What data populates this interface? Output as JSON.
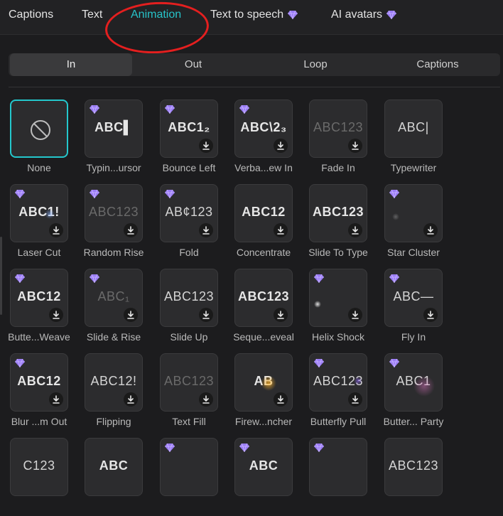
{
  "top_tabs": [
    {
      "label": "Captions",
      "active": false,
      "premium": false
    },
    {
      "label": "Text",
      "active": false,
      "premium": false
    },
    {
      "label": "Animation",
      "active": true,
      "premium": false
    },
    {
      "label": "Text to speech",
      "active": false,
      "premium": true
    },
    {
      "label": "AI avatars",
      "active": false,
      "premium": true
    }
  ],
  "sub_tabs": [
    {
      "label": "In",
      "active": true
    },
    {
      "label": "Out",
      "active": false
    },
    {
      "label": "Loop",
      "active": false
    },
    {
      "label": "Captions",
      "active": false
    }
  ],
  "colors": {
    "accent": "#27c3c9",
    "premium_gem": "#9b7cf6",
    "annotation": "#e41f1f"
  },
  "animations": [
    {
      "label": "None",
      "sample": "",
      "premium": false,
      "download": false,
      "selected": true,
      "icon": "none-icon"
    },
    {
      "label": "Typin...ursor",
      "sample": "ABC▌",
      "premium": true,
      "download": false
    },
    {
      "label": "Bounce Left",
      "sample": "ABC1₂",
      "premium": true,
      "download": true
    },
    {
      "label": "Verba...ew In",
      "sample": "ABC\\2₃",
      "premium": true,
      "download": true
    },
    {
      "label": "Fade In",
      "sample": "ABC123",
      "premium": false,
      "download": true,
      "style": "dim"
    },
    {
      "label": "Typewriter",
      "sample": "ABC|",
      "premium": false,
      "download": false,
      "style": "light"
    },
    {
      "label": "Laser Cut",
      "sample": "ABC1!",
      "premium": true,
      "download": true
    },
    {
      "label": "Random Rise",
      "sample": "ABC123",
      "premium": true,
      "download": true,
      "style": "dim"
    },
    {
      "label": "Fold",
      "sample": "AB¢123",
      "premium": true,
      "download": true,
      "style": "light"
    },
    {
      "label": "Concentrate",
      "sample": "ABC12",
      "premium": false,
      "download": true
    },
    {
      "label": "Slide To Type",
      "sample": "ABC123",
      "premium": false,
      "download": true
    },
    {
      "label": "Star Cluster",
      "sample": "",
      "premium": true,
      "download": true
    },
    {
      "label": "Butte...Weave",
      "sample": "ABC12",
      "premium": true,
      "download": true
    },
    {
      "label": "Slide & Rise",
      "sample": "ABC₁",
      "premium": true,
      "download": true,
      "style": "dim"
    },
    {
      "label": "Slide Up",
      "sample": "ABC123",
      "premium": false,
      "download": true,
      "style": "light"
    },
    {
      "label": "Seque...eveal",
      "sample": "ABC123",
      "premium": false,
      "download": true
    },
    {
      "label": "Helix Shock",
      "sample": "",
      "premium": true,
      "download": true
    },
    {
      "label": "Fly In",
      "sample": "ABC—",
      "premium": true,
      "download": true,
      "style": "light"
    },
    {
      "label": "Blur ...m Out",
      "sample": "ABC12",
      "premium": true,
      "download": true
    },
    {
      "label": "Flipping",
      "sample": "ABC12!",
      "premium": false,
      "download": true,
      "style": "light"
    },
    {
      "label": "Text Fill",
      "sample": "ABC123",
      "premium": false,
      "download": true,
      "style": "dim"
    },
    {
      "label": "Firew...ncher",
      "sample": "AB",
      "premium": false,
      "download": true
    },
    {
      "label": "Butterfly Pull",
      "sample": "ABC123",
      "premium": true,
      "download": true,
      "style": "light"
    },
    {
      "label": "Butter... Party",
      "sample": "ABC1",
      "premium": true,
      "download": false,
      "style": "light"
    },
    {
      "label": "",
      "sample": "C123",
      "premium": false,
      "download": false,
      "style": "light"
    },
    {
      "label": "",
      "sample": "ABC",
      "premium": false,
      "download": false
    },
    {
      "label": "",
      "sample": "",
      "premium": true,
      "download": false
    },
    {
      "label": "",
      "sample": "ABC",
      "premium": true,
      "download": false
    },
    {
      "label": "",
      "sample": "",
      "premium": true,
      "download": false
    },
    {
      "label": "",
      "sample": "ABC123",
      "premium": false,
      "download": false,
      "style": "light"
    }
  ]
}
